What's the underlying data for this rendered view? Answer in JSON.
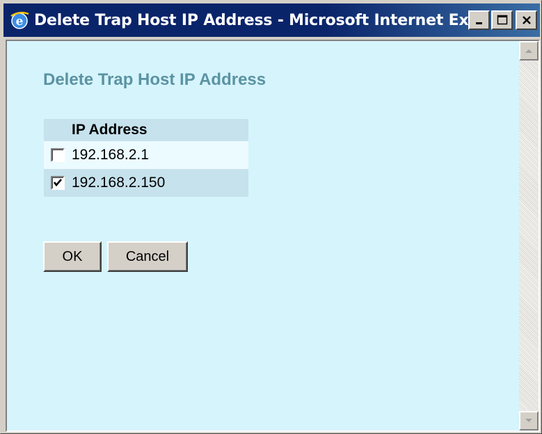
{
  "window": {
    "title": "Delete Trap Host IP Address - Microsoft Internet Expl..."
  },
  "page": {
    "title": "Delete Trap Host IP Address",
    "table": {
      "header": "IP Address",
      "rows": [
        {
          "ip": "192.168.2.1",
          "checked": false
        },
        {
          "ip": "192.168.2.150",
          "checked": true
        }
      ]
    },
    "buttons": {
      "ok": "OK",
      "cancel": "Cancel"
    }
  },
  "colors": {
    "background": "#d6f4fc",
    "title_text": "#5b93a3",
    "header_row": "#c6e2ed",
    "row_alt": "#ecfbff",
    "titlebar": "#0a246a"
  }
}
